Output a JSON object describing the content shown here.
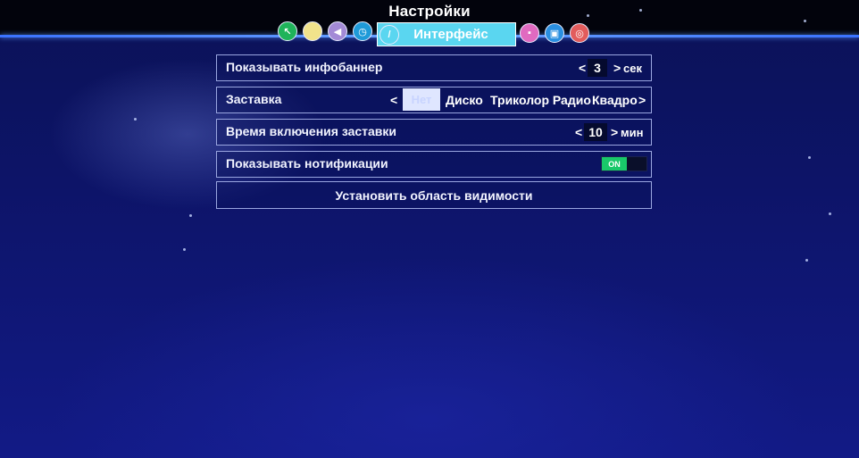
{
  "header": {
    "title": "Настройки",
    "active_tab": "Интерфейс",
    "colors": {
      "bar": "#02030c",
      "accent_line": "#3a72ff",
      "active_tab_bg": "#5ad6f0"
    },
    "icons": [
      {
        "name": "green-icon",
        "color": "#1fb35a",
        "glyph": "↖"
      },
      {
        "name": "yellow-icon",
        "color": "#f1e38b",
        "glyph": ""
      },
      {
        "name": "sound-icon",
        "color": "#a38ad6",
        "glyph": "◀"
      },
      {
        "name": "clock-icon",
        "color": "#1f9ad8",
        "glyph": "◷"
      },
      {
        "name": "interface-icon",
        "color": "#5ad6f0",
        "glyph": "/"
      },
      {
        "name": "lock-icon",
        "color": "#e06ac0",
        "glyph": "🔒"
      },
      {
        "name": "tv-icon",
        "color": "#2a8fe0",
        "glyph": "▣"
      },
      {
        "name": "lifebuoy-icon",
        "color": "#e25c5c",
        "glyph": "◎"
      }
    ]
  },
  "settings": {
    "infobanner": {
      "label": "Показывать инфобаннер",
      "value": "3",
      "unit": "сек",
      "left_arrow": "<",
      "right_arrow": ">"
    },
    "screensaver": {
      "label": "Заставка",
      "left_arrow": "<",
      "right_arrow": ">",
      "options": [
        "Нет",
        "Диско",
        "Триколор Радио",
        "Квадро"
      ],
      "selected": "Нет"
    },
    "screensaver_time": {
      "label": "Время включения заставки",
      "value": "10",
      "unit": "мин",
      "left_arrow": "<",
      "right_arrow": ">"
    },
    "notifications": {
      "label": "Показывать нотификации",
      "toggle": "ON",
      "on_color": "#19c86a"
    },
    "visibility": {
      "label": "Установить область видимости"
    }
  }
}
